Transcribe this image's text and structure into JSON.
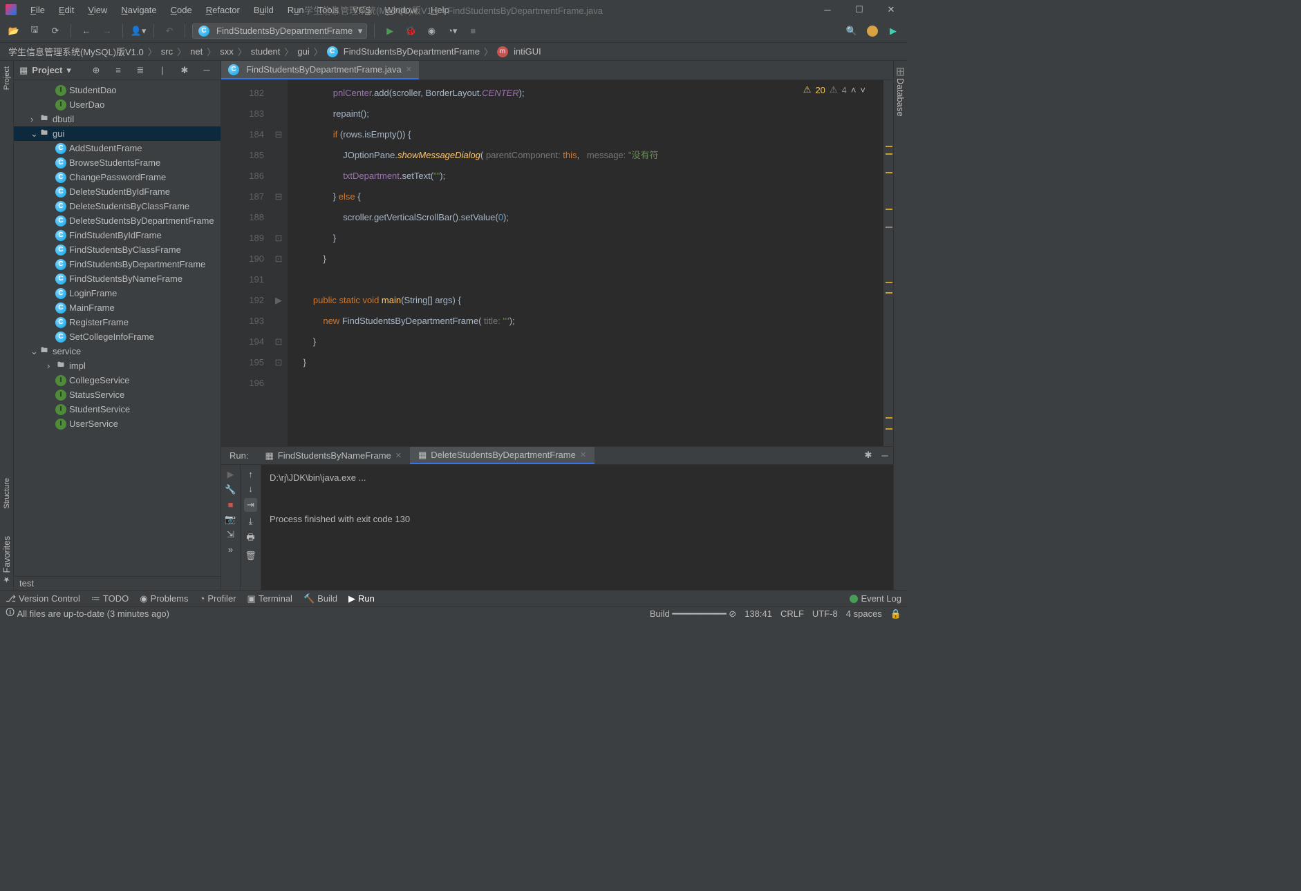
{
  "window": {
    "title": "学生信息管理系统(MySQL)版V1.0 - FindStudentsByDepartmentFrame.java"
  },
  "menu": {
    "file": "File",
    "edit": "Edit",
    "view": "View",
    "navigate": "Navigate",
    "code": "Code",
    "refactor": "Refactor",
    "build": "Build",
    "run": "Run",
    "tools": "Tools",
    "vcs": "VCS",
    "window": "Window",
    "help": "Help"
  },
  "toolbar": {
    "run_config": "FindStudentsByDepartmentFrame"
  },
  "breadcrumbs": [
    "学生信息管理系统(MySQL)版V1.0",
    "src",
    "net",
    "sxx",
    "student",
    "gui",
    "FindStudentsByDepartmentFrame",
    "intiGUI"
  ],
  "project_panel": {
    "title": "Project",
    "tree": {
      "studentdao": "StudentDao",
      "userdao": "UserDao",
      "dbutil": "dbutil",
      "gui": "gui",
      "gui_items": [
        "AddStudentFrame",
        "BrowseStudentsFrame",
        "ChangePasswordFrame",
        "DeleteStudentByIdFrame",
        "DeleteStudentsByClassFrame",
        "DeleteStudentsByDepartmentFrame",
        "FindStudentByIdFrame",
        "FindStudentsByClassFrame",
        "FindStudentsByDepartmentFrame",
        "FindStudentsByNameFrame",
        "LoginFrame",
        "MainFrame",
        "RegisterFrame",
        "SetCollegeInfoFrame"
      ],
      "service": "service",
      "impl": "impl",
      "service_items": [
        "CollegeService",
        "StatusService",
        "StudentService",
        "UserService"
      ],
      "test": "test"
    }
  },
  "editor": {
    "tab": "FindStudentsByDepartmentFrame.java",
    "warn_count": "20",
    "weak_count": "4",
    "line_start": 182,
    "lines": [
      "182",
      "183",
      "184",
      "185",
      "186",
      "187",
      "188",
      "189",
      "190",
      "191",
      "192",
      "193",
      "194",
      "195",
      "196"
    ],
    "code": {
      "l182": {
        "pre": "                ",
        "a": "pnlCenter",
        "b": ".add(scroller, BorderLayout.",
        "c": "CENTER",
        "d": ");"
      },
      "l183": {
        "pre": "                ",
        "a": "repaint();"
      },
      "l184": {
        "pre": "                ",
        "kw": "if",
        "a": " (rows.isEmpty()) {"
      },
      "l185": {
        "pre": "                    ",
        "a": "JOptionPane.",
        "fn": "showMessageDialog",
        "b": "(",
        "hint1": " parentComponent: ",
        "kw": "this",
        "c": ",",
        "hint2": "   message: ",
        "str": "\"没有符"
      },
      "l186": {
        "pre": "                    ",
        "a": "txtDepartment",
        "b": ".setText(",
        "str": "\"\"",
        "c": ");"
      },
      "l187": {
        "pre": "                ",
        "a": "} ",
        "kw": "else",
        "b": " {"
      },
      "l188": {
        "pre": "                    ",
        "a": "scroller.getVerticalScrollBar().setValue(",
        "num": "0",
        "b": ");"
      },
      "l189": {
        "pre": "                ",
        "a": "}"
      },
      "l190": {
        "pre": "            ",
        "a": "}"
      },
      "l191": {
        "pre": "",
        "a": ""
      },
      "l192": {
        "pre": "        ",
        "kw1": "public",
        "kw2": " static",
        "kw3": " void",
        "fn": " main",
        "a": "(String[] args) {"
      },
      "l193": {
        "pre": "            ",
        "kw": "new",
        "a": " FindStudentsByDepartmentFrame(",
        "hint": " title: ",
        "str": "\"\"",
        "b": ");"
      },
      "l194": {
        "pre": "        ",
        "a": "}"
      },
      "l195": {
        "pre": "    ",
        "a": "}"
      },
      "l196": {
        "pre": "",
        "a": ""
      }
    }
  },
  "run": {
    "label": "Run:",
    "tab1": "FindStudentsByNameFrame",
    "tab2": "DeleteStudentsByDepartmentFrame",
    "line1": "D:\\rj\\JDK\\bin\\java.exe ...",
    "line2": "",
    "line3": "Process finished with exit code 130"
  },
  "sidebar": {
    "project": "Project",
    "structure": "Structure",
    "favorites": "Favorites",
    "database": "Database"
  },
  "bottom": {
    "vc": "Version Control",
    "todo": "TODO",
    "problems": "Problems",
    "profiler": "Profiler",
    "terminal": "Terminal",
    "build": "Build",
    "run": "Run",
    "event_log": "Event Log"
  },
  "status": {
    "msg": "All files are up-to-date (3 minutes ago)",
    "build": "Build",
    "pos": "138:41",
    "eol": "CRLF",
    "enc": "UTF-8",
    "indent": "4 spaces"
  }
}
